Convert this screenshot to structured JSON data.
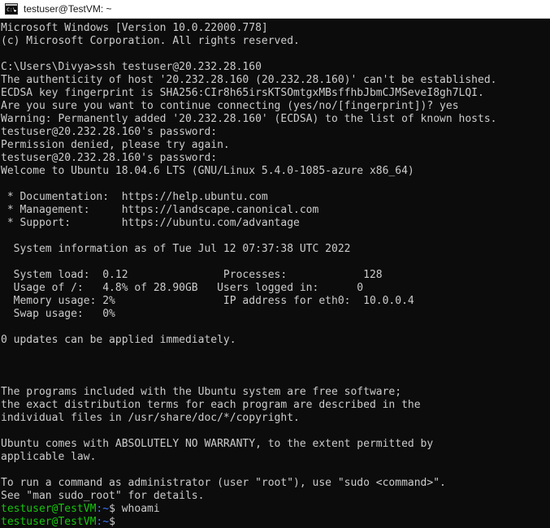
{
  "window": {
    "titlebar": {
      "icon": "console-icon",
      "title": "testuser@TestVM: ~"
    },
    "colors": {
      "terminal_background": "#0c0c0c",
      "terminal_foreground": "#cccccc",
      "prompt_user_host": "#16c60c",
      "prompt_path": "#3b78ff",
      "titlebar_background": "#ffffff",
      "titlebar_foreground": "#1a1a1a"
    }
  },
  "terminal": {
    "lines": [
      {
        "type": "text",
        "text": "Microsoft Windows [Version 10.0.22000.778]"
      },
      {
        "type": "text",
        "text": "(c) Microsoft Corporation. All rights reserved."
      },
      {
        "type": "blank",
        "text": ""
      },
      {
        "type": "text",
        "text": "C:\\Users\\Divya>ssh testuser@20.232.28.160"
      },
      {
        "type": "text",
        "text": "The authenticity of host '20.232.28.160 (20.232.28.160)' can't be established."
      },
      {
        "type": "text",
        "text": "ECDSA key fingerprint is SHA256:CIr8h65irsKTSOmtgxMBsffhbJbmCJMSeveI8gh7LQI."
      },
      {
        "type": "text",
        "text": "Are you sure you want to continue connecting (yes/no/[fingerprint])? yes"
      },
      {
        "type": "text",
        "text": "Warning: Permanently added '20.232.28.160' (ECDSA) to the list of known hosts."
      },
      {
        "type": "text",
        "text": "testuser@20.232.28.160's password:"
      },
      {
        "type": "text",
        "text": "Permission denied, please try again."
      },
      {
        "type": "text",
        "text": "testuser@20.232.28.160's password:"
      },
      {
        "type": "text",
        "text": "Welcome to Ubuntu 18.04.6 LTS (GNU/Linux 5.4.0-1085-azure x86_64)"
      },
      {
        "type": "blank",
        "text": ""
      },
      {
        "type": "text",
        "text": " * Documentation:  https://help.ubuntu.com"
      },
      {
        "type": "text",
        "text": " * Management:     https://landscape.canonical.com"
      },
      {
        "type": "text",
        "text": " * Support:        https://ubuntu.com/advantage"
      },
      {
        "type": "blank",
        "text": ""
      },
      {
        "type": "text",
        "text": "  System information as of Tue Jul 12 07:37:38 UTC 2022"
      },
      {
        "type": "blank",
        "text": ""
      },
      {
        "type": "text",
        "text": "  System load:  0.12               Processes:            128"
      },
      {
        "type": "text",
        "text": "  Usage of /:   4.8% of 28.90GB   Users logged in:      0"
      },
      {
        "type": "text",
        "text": "  Memory usage: 2%                 IP address for eth0:  10.0.0.4"
      },
      {
        "type": "text",
        "text": "  Swap usage:   0%"
      },
      {
        "type": "blank",
        "text": ""
      },
      {
        "type": "text",
        "text": "0 updates can be applied immediately."
      },
      {
        "type": "blank",
        "text": ""
      },
      {
        "type": "blank",
        "text": ""
      },
      {
        "type": "blank",
        "text": ""
      },
      {
        "type": "text",
        "text": "The programs included with the Ubuntu system are free software;"
      },
      {
        "type": "text",
        "text": "the exact distribution terms for each program are described in the"
      },
      {
        "type": "text",
        "text": "individual files in /usr/share/doc/*/copyright."
      },
      {
        "type": "blank",
        "text": ""
      },
      {
        "type": "text",
        "text": "Ubuntu comes with ABSOLUTELY NO WARRANTY, to the extent permitted by"
      },
      {
        "type": "text",
        "text": "applicable law."
      },
      {
        "type": "blank",
        "text": ""
      },
      {
        "type": "text",
        "text": "To run a command as administrator (user \"root\"), use \"sudo <command>\"."
      },
      {
        "type": "text",
        "text": "See \"man sudo_root\" for details."
      },
      {
        "type": "prompt",
        "user_host": "testuser@TestVM",
        "path": ":~",
        "dollar": "$",
        "command": " whoami"
      },
      {
        "type": "prompt",
        "user_host": "testuser@TestVM",
        "path": ":~",
        "dollar": "$",
        "command": ""
      }
    ]
  }
}
